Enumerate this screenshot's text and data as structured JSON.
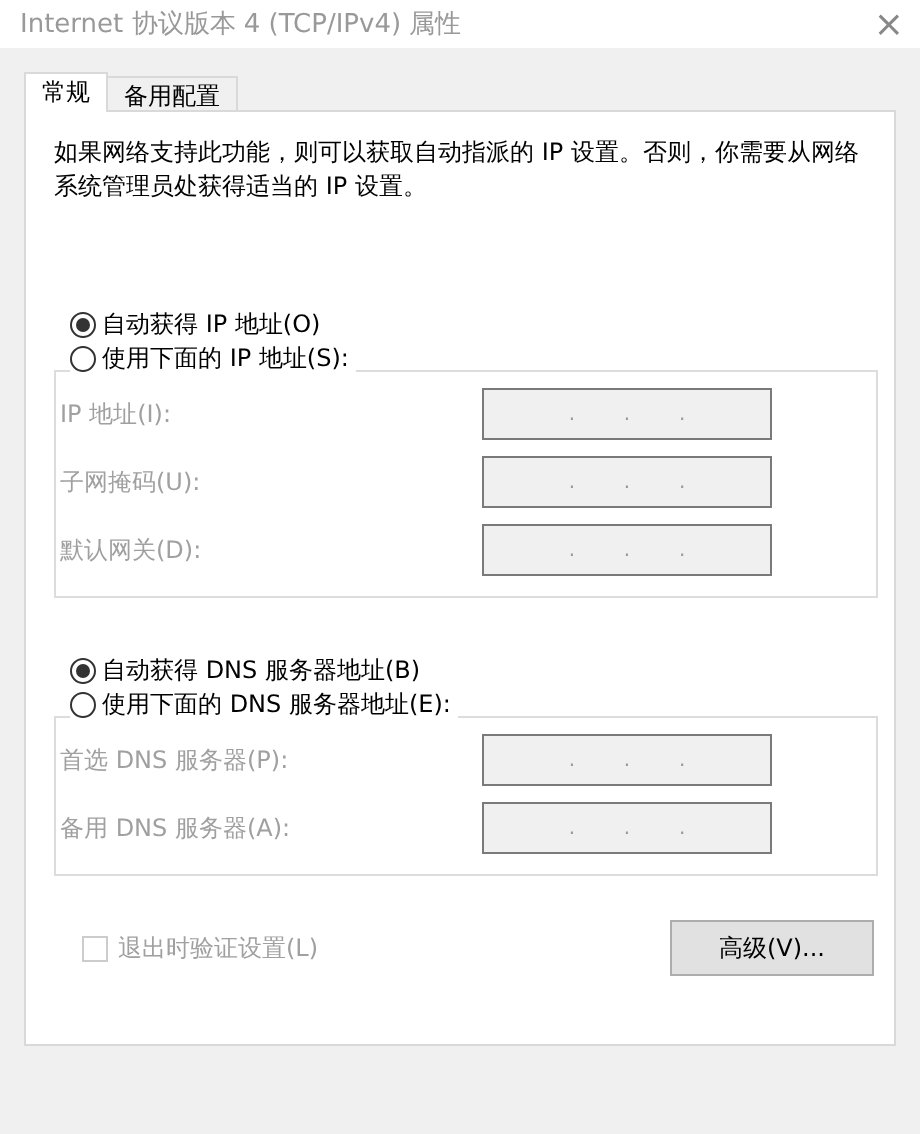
{
  "window": {
    "title": "Internet 协议版本 4 (TCP/IPv4) 属性",
    "close": "×"
  },
  "tabs": [
    {
      "label": "常规",
      "selected": true
    },
    {
      "label": "备用配置",
      "selected": false
    }
  ],
  "description": "如果网络支持此功能，则可以获取自动指派的 IP 设置。否则，你需要从网络系统管理员处获得适当的 IP 设置。",
  "sections": [
    {
      "auto_option": {
        "label": "自动获得 IP 地址(O)",
        "selected": true
      },
      "manual_option": {
        "label": "使用下面的 IP 地址(S):",
        "selected": false
      },
      "fields": [
        {
          "label": "IP 地址(I):",
          "disabled": true,
          "separators": [
            ".",
            ".",
            "."
          ]
        },
        {
          "label": "子网掩码(U):",
          "disabled": true,
          "separators": [
            ".",
            ".",
            "."
          ]
        },
        {
          "label": "默认网关(D):",
          "disabled": true,
          "separators": [
            ".",
            ".",
            "."
          ]
        }
      ]
    },
    {
      "auto_option": {
        "label": "自动获得 DNS 服务器地址(B)",
        "selected": true
      },
      "manual_option": {
        "label": "使用下面的 DNS 服务器地址(E):",
        "selected": false
      },
      "fields": [
        {
          "label": "首选 DNS 服务器(P):",
          "disabled": true,
          "separators": [
            ".",
            ".",
            "."
          ]
        },
        {
          "label": "备用 DNS 服务器(A):",
          "disabled": true,
          "separators": [
            ".",
            ".",
            "."
          ]
        }
      ]
    }
  ],
  "validate": {
    "label": "退出时验证设置(L)",
    "checked": false,
    "disabled": true
  },
  "advanced_button": "高级(V)..."
}
